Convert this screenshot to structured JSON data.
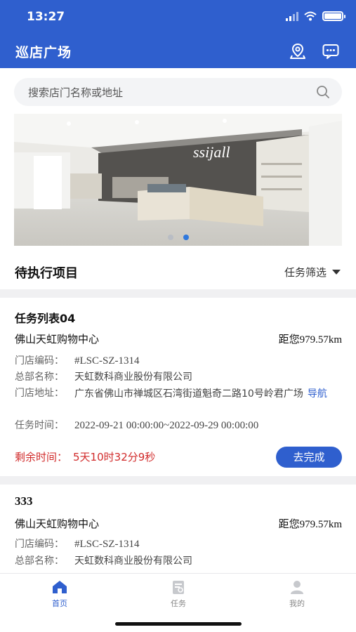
{
  "status_bar": {
    "time": "13:27"
  },
  "header": {
    "title": "巡店广场"
  },
  "search": {
    "placeholder": "搜索店门名称或地址"
  },
  "banner": {
    "sign_text": "ssijall",
    "slides": 2,
    "active_slide": 2
  },
  "section": {
    "title": "待执行项目",
    "filter_label": "任务筛选"
  },
  "labels": {
    "code": "门店编码：",
    "hq": "总部名称：",
    "address": "门店地址：",
    "time": "任务时间：",
    "remaining": "剩余时间：",
    "navigate": "导航",
    "complete_button": "去完成"
  },
  "tasks": [
    {
      "title": "任务列表04",
      "store": "佛山天虹购物中心",
      "distance_prefix": "距您",
      "distance_value": "979.57km",
      "code": "#LSC-SZ-1314",
      "hq": "天虹数科商业股份有限公司",
      "address": "广东省佛山市禅城区石湾街道魁奇二路10号岭君广场",
      "time": "2022-09-21 00:00:00~2022-09-29 00:00:00",
      "remaining": "5天10时32分9秒"
    },
    {
      "title": "333",
      "store": "佛山天虹购物中心",
      "distance_prefix": "距您",
      "distance_value": "979.57km",
      "code": "#LSC-SZ-1314",
      "hq": "天虹数科商业股份有限公司"
    }
  ],
  "tabbar": [
    {
      "label": "首页",
      "icon": "home-icon",
      "active": true
    },
    {
      "label": "任务",
      "icon": "task-icon",
      "active": false
    },
    {
      "label": "我的",
      "icon": "user-icon",
      "active": false
    }
  ],
  "colors": {
    "primary": "#2f5fce",
    "countdown": "#d12b2b",
    "divider": "#f0f0f2"
  }
}
